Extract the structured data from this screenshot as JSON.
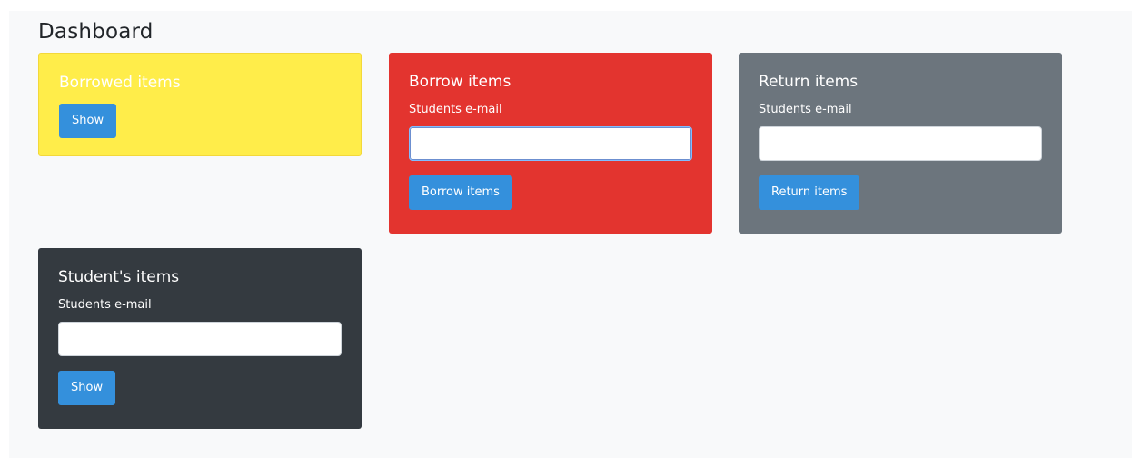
{
  "page": {
    "title": "Dashboard"
  },
  "cards": {
    "borrowed": {
      "title": "Borrowed items",
      "button_label": "Show"
    },
    "borrow": {
      "title": "Borrow items",
      "field_label": "Students e-mail",
      "input_value": "",
      "button_label": "Borrow items"
    },
    "return": {
      "title": "Return items",
      "field_label": "Students e-mail",
      "input_value": "",
      "button_label": "Return items"
    },
    "student": {
      "title": "Student's items",
      "field_label": "Students e-mail",
      "input_value": "",
      "button_label": "Show"
    }
  },
  "colors": {
    "yellow": "#ffed4a",
    "red": "#e3342f",
    "gray": "#6c757d",
    "dark": "#343a40",
    "button": "#3490dc"
  }
}
